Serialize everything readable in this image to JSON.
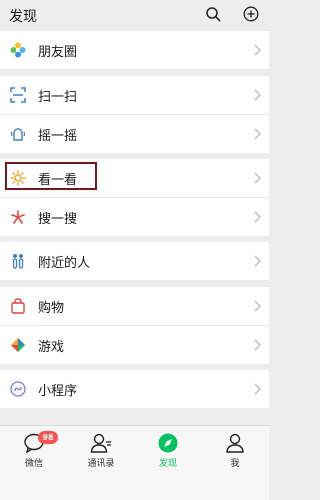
{
  "header": {
    "title": "发现",
    "search_icon": "search-icon",
    "add_icon": "plus-circle-icon"
  },
  "items": [
    {
      "label": "朋友圈",
      "icon": "moments-icon"
    },
    {
      "label": "扫一扫",
      "icon": "scan-icon"
    },
    {
      "label": "摇一摇",
      "icon": "shake-icon"
    },
    {
      "label": "看一看",
      "icon": "top-stories-icon"
    },
    {
      "label": "搜一搜",
      "icon": "search-sparkle-icon"
    },
    {
      "label": "附近的人",
      "icon": "people-nearby-icon"
    },
    {
      "label": "购物",
      "icon": "shopping-bag-icon"
    },
    {
      "label": "游戏",
      "icon": "games-icon"
    },
    {
      "label": "小程序",
      "icon": "mini-programs-icon"
    }
  ],
  "tabbar": {
    "tabs": [
      {
        "label": "微信",
        "icon": "chat-icon"
      },
      {
        "label": "通讯录",
        "icon": "contacts-icon"
      },
      {
        "label": "发现",
        "icon": "discover-compass-icon"
      },
      {
        "label": "我",
        "icon": "me-icon"
      }
    ],
    "badge": "98",
    "active_color": "#07c160"
  }
}
